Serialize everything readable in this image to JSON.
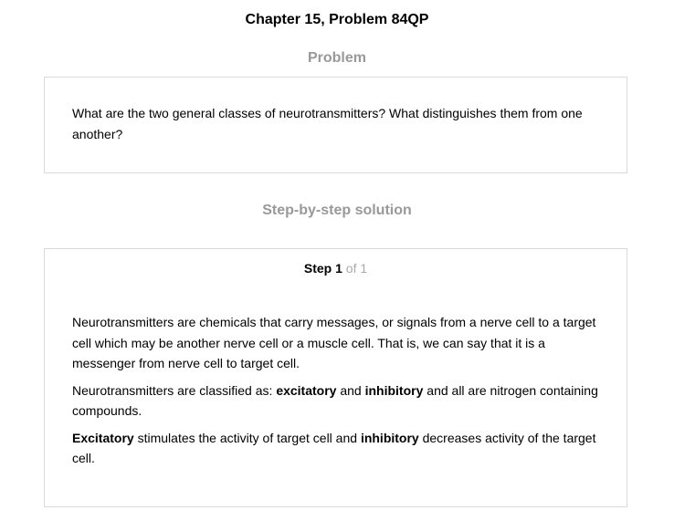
{
  "title": "Chapter 15, Problem 84QP",
  "problem": {
    "heading": "Problem",
    "text": "What are the two general classes of neurotransmitters? What distinguishes them from one another?"
  },
  "solution": {
    "heading": "Step-by-step solution",
    "step": {
      "word": "Step",
      "number": "1",
      "of": "of 1"
    },
    "paragraph1": "Neurotransmitters are chemicals that carry messages, or signals from a nerve cell to a target cell which may be another nerve cell or a muscle cell. That is, we can say that it is a messenger from nerve cell to target cell.",
    "paragraph2": {
      "part1": "Neurotransmitters are classified as: ",
      "bold1": "excitatory",
      "part2": " and ",
      "bold2": "inhibitory",
      "part3": " and all are nitrogen containing compounds."
    },
    "paragraph3": {
      "bold1": "Excitatory",
      "part1": " stimulates the activity of target cell and ",
      "bold2": "inhibitory",
      "part2": " decreases activity of the target cell."
    }
  }
}
